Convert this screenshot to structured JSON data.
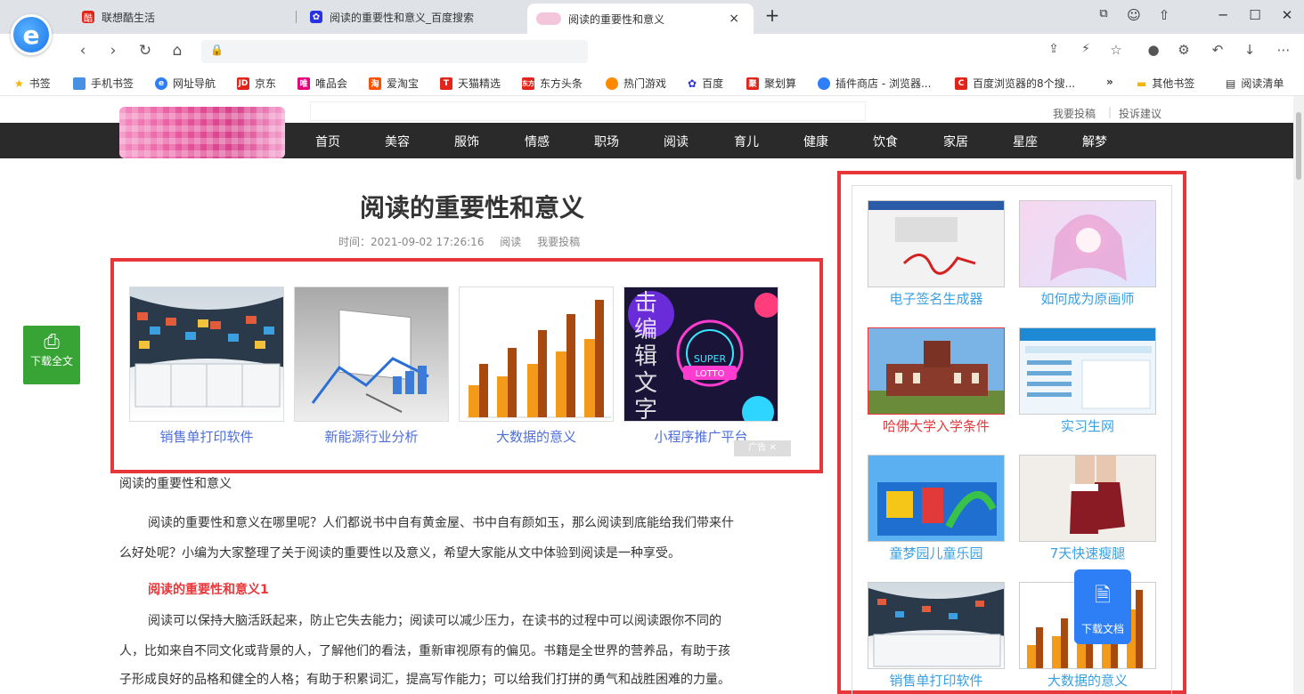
{
  "tabs": [
    {
      "label": "联想酷生活"
    },
    {
      "label": "阅读的重要性和意义_百度搜索"
    },
    {
      "label": "阅读的重要性和意义",
      "active": true
    }
  ],
  "tab_close": "×",
  "tab_new": "+",
  "window_controls": [
    "─",
    "☐",
    "✕"
  ],
  "bookmarks": [
    {
      "label": "书签",
      "color": "#f5b400"
    },
    {
      "label": "手机书签",
      "color": "#4a90e2"
    },
    {
      "label": "网址导航",
      "color": "#2e7ef5"
    },
    {
      "label": "京东",
      "color": "#e1251b",
      "mark": "JD"
    },
    {
      "label": "唯品会",
      "color": "#e6007e",
      "mark": "唯"
    },
    {
      "label": "爱淘宝",
      "color": "#ff5000",
      "mark": "淘"
    },
    {
      "label": "天猫精选",
      "color": "#e1251b",
      "mark": "T"
    },
    {
      "label": "东方头条",
      "color": "#e1251b",
      "mark": "东方"
    },
    {
      "label": "热门游戏",
      "color": "#ff8a00"
    },
    {
      "label": "百度",
      "color": "#2932e1"
    },
    {
      "label": "聚划算",
      "color": "#e1251b",
      "mark": "聚"
    },
    {
      "label": "插件商店 - 浏览器...",
      "color": "#2e7ef5"
    },
    {
      "label": "百度浏览器的8个搜...",
      "color": "#e1251b",
      "mark": "C"
    }
  ],
  "bookmarks_more": "»",
  "bookmarks_right": [
    {
      "label": "其他书签"
    },
    {
      "label": "阅读清单"
    }
  ],
  "site": {
    "top_links": [
      "我要投稿",
      "投诉建议"
    ],
    "nav": [
      "首页",
      "美容",
      "服饰",
      "情感",
      "职场",
      "阅读",
      "育儿",
      "健康",
      "饮食",
      "家居",
      "星座",
      "解梦"
    ],
    "title": "阅读的重要性和意义",
    "meta": {
      "time": "时间：2021-09-02 17:26:16",
      "category": "阅读",
      "submit": "我要投稿"
    },
    "ads": [
      {
        "caption": "销售单打印软件"
      },
      {
        "caption": "新能源行业分析"
      },
      {
        "caption": "大数据的意义"
      },
      {
        "caption": "小程序推广平台"
      }
    ],
    "ad_badge": "广告 ✕",
    "watermark": "点击编辑文字",
    "download_left": "下载全文",
    "sidebar": [
      {
        "caption": "电子签名生成器"
      },
      {
        "caption": "如何成为原画师"
      },
      {
        "caption": "哈佛大学入学条件",
        "highlight": true
      },
      {
        "caption": "实习生网"
      },
      {
        "caption": "童梦园儿童乐园"
      },
      {
        "caption": "7天快速瘦腿"
      },
      {
        "caption": "销售单打印软件"
      },
      {
        "caption": "大数据的意义"
      }
    ],
    "download_doc": "下载文档",
    "body_heading": "阅读的重要性和意义",
    "para1_l1": "阅读的重要性和意义在哪里呢？人们都说书中自有黄金屋、书中自有颜如玉，那么阅读到底能给我们带来什",
    "para1_l2": "么好处呢？小编为大家整理了关于阅读的重要性以及意义，希望大家能从文中体验到阅读是一种享受。",
    "subhead": "阅读的重要性和意义1",
    "para2_l1": "阅读可以保持大脑活跃起来，防止它失去能力；阅读可以减少压力，在读书的过程中可以阅读跟你不同的",
    "para2_l2": "人，比如来自不同文化或背景的人，了解他们的看法，重新审视原有的偏见。书籍是全世界的营养品，有助于孩",
    "para2_l3": "子形成良好的品格和健全的人格；有助于积累词汇，提高写作能力；可以给我们打拼的勇气和战胜困难的力量。"
  },
  "colors": {
    "accent_red": "#e8373a",
    "link_blue": "#4f6fd8",
    "side_link": "#3aa0e2",
    "nav_bg": "#2a2a2a"
  }
}
